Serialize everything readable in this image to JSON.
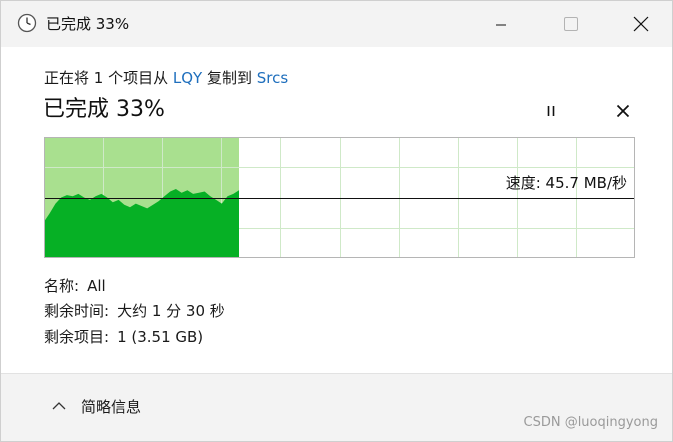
{
  "window": {
    "title": "已完成 33%",
    "title_icon": "clock-icon"
  },
  "operation": {
    "prefix": "正在将 1 个项目从 ",
    "source": "LQY",
    "middle": " 复制到 ",
    "destination": "Srcs"
  },
  "status": {
    "big_text": "已完成 33%",
    "progress_percent": 33
  },
  "controls": {
    "pause_icon": "pause-icon",
    "cancel_icon": "close-icon"
  },
  "graph": {
    "speed_text": "速度: 45.7 MB/秒",
    "current_speed_mb": 45.7,
    "colors": {
      "progress_fill": "#a9e08f",
      "speed_fill": "#06b025",
      "grid": "#cfe9c8",
      "border": "#b5b5b5",
      "speed_line": "#111111"
    }
  },
  "details": {
    "name_label": "名称:",
    "name_value": "All",
    "time_label": "剩余时间:",
    "time_value": "大约 1 分 30 秒",
    "items_label": "剩余项目:",
    "items_value": "1 (3.51 GB)"
  },
  "footer": {
    "toggle_label": "简略信息",
    "toggle_icon": "chevron-up-icon",
    "watermark": "CSDN @luoqingyong"
  }
}
